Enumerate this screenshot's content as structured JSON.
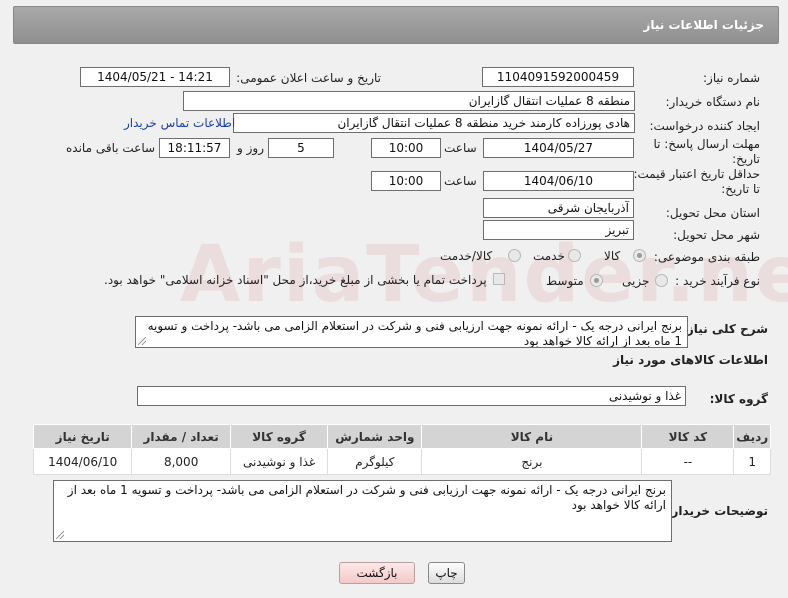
{
  "header": {
    "title": "جزئیات اطلاعات نیاز"
  },
  "watermark": "AriaTender.neT",
  "form": {
    "need_number_label": "شماره نیاز:",
    "need_number": "1104091592000459",
    "announce_label": "تاریخ و ساعت اعلان عمومی:",
    "announce_value": "1404/05/21 - 14:21",
    "buyer_org_label": "نام دستگاه خریدار:",
    "buyer_org": "منطقه 8 عملیات انتقال گازایران",
    "creator_label": "ایجاد کننده درخواست:",
    "creator": "هادی پورزاده کارمند خرید منطقه 8 عملیات انتقال گازایران",
    "contact_link": "اطلاعات تماس خریدار",
    "deadline_label_1": "مهلت ارسال پاسخ: تا",
    "deadline_label_2": "تاریخ:",
    "deadline_date": "1404/05/27",
    "time_label": "ساعت",
    "deadline_time": "10:00",
    "days_value": "5",
    "days_label": "روز و",
    "remaining_time": "18:11:57",
    "remaining_label": "ساعت باقی مانده",
    "validity_label_1": "حداقل تاریخ اعتبار قیمت:",
    "validity_label_2": "تا تاریخ:",
    "validity_date": "1404/06/10",
    "validity_time": "10:00",
    "province_label": "استان محل تحویل:",
    "province": "آذربایجان شرقی",
    "city_label": "شهر محل تحویل:",
    "city": "تبریز",
    "category_label": "طبقه بندی موضوعی:",
    "category_options": [
      "کالا",
      "خدمت",
      "کالا/خدمت"
    ],
    "process_label": "نوع فرآیند خرید :",
    "process_options": [
      "جزیی",
      "متوسط"
    ],
    "payment_note": "پرداخت تمام یا بخشی از مبلغ خرید،از محل \"اسناد خزانه اسلامی\" خواهد بود.",
    "general_desc_label": "شرح کلی نیاز:",
    "general_desc": "برنج ایرانی درجه یک - ارائه نمونه جهت ارزیابی فنی و شرکت در استعلام الزامی می باشد- پرداخت و تسویه 1 ماه بعد از ارائه کالا خواهد بود"
  },
  "goods": {
    "section_title": "اطلاعات کالاهای مورد نیاز",
    "group_label": "گروه کالا:",
    "group_value": "غذا و نوشیدنی",
    "columns": [
      "ردیف",
      "کد کالا",
      "نام کالا",
      "واحد شمارش",
      "گروه کالا",
      "تعداد / مقدار",
      "تاریخ نیاز"
    ],
    "rows": [
      [
        "1",
        "--",
        "برنج",
        "کیلوگرم",
        "غذا و نوشیدنی",
        "8,000",
        "1404/06/10"
      ]
    ]
  },
  "buyer_notes": {
    "label": "توضیحات خریدار:",
    "text": "برنج ایرانی درجه یک - ارائه نمونه جهت ارزیابی فنی و شرکت در استعلام الزامی می باشد- پرداخت و تسویه 1 ماه بعد از ارائه کالا خواهد بود"
  },
  "buttons": {
    "print": "چاپ",
    "back": "بازگشت"
  }
}
